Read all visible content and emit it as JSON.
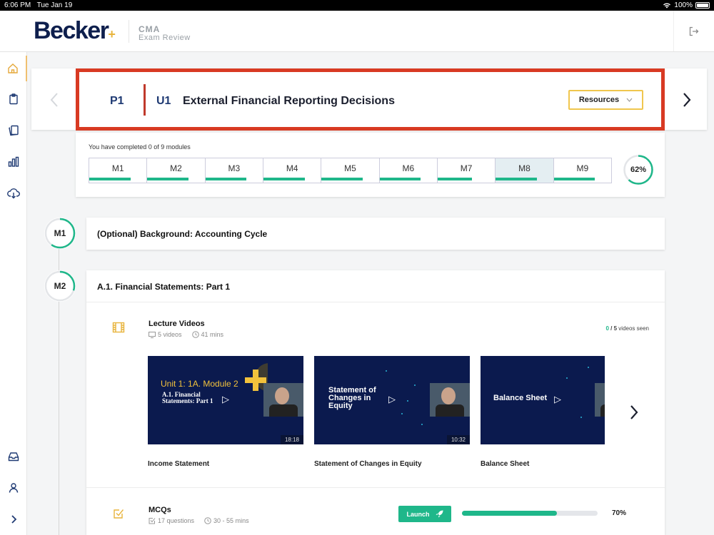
{
  "status": {
    "time": "6:06 PM",
    "date": "Tue Jan 19",
    "battery": "100%"
  },
  "header": {
    "logo": "Becker",
    "product_line1": "CMA",
    "product_line2": "Exam Review"
  },
  "banner": {
    "part": "P1",
    "unit": "U1",
    "title": "External Financial Reporting Decisions",
    "resources_label": "Resources"
  },
  "progress": {
    "summary": "You have completed 0 of 9 modules",
    "modules": [
      {
        "label": "M1",
        "fill": 0.72
      },
      {
        "label": "M2",
        "fill": 0.72
      },
      {
        "label": "M3",
        "fill": 0.72
      },
      {
        "label": "M4",
        "fill": 0.72
      },
      {
        "label": "M5",
        "fill": 0.72
      },
      {
        "label": "M6",
        "fill": 0.72
      },
      {
        "label": "M7",
        "fill": 0.6
      },
      {
        "label": "M8",
        "fill": 0.72
      },
      {
        "label": "M9",
        "fill": 0.72
      }
    ],
    "overall_label": "62%",
    "overall_value": 0.62
  },
  "module1": {
    "badge": "M1",
    "title": "(Optional) Background: Accounting Cycle",
    "ring": 0.6
  },
  "module2": {
    "badge": "M2",
    "title": "A.1. Financial Statements: Part 1",
    "ring": 0.3,
    "lecture": {
      "heading": "Lecture Videos",
      "videos_count": "5 videos",
      "duration": "41 mins",
      "seen_num": "0",
      "seen_total": "/ 5",
      "seen_label": "videos seen",
      "videos": [
        {
          "thumb_line1": "Unit 1: 1A. Module 2",
          "thumb_line2": "A.1. Financial",
          "thumb_line3": "Statements: Part 1",
          "duration": "18:18",
          "title": "Income Statement"
        },
        {
          "thumb_line1": "Statement of",
          "thumb_line2": "Changes in",
          "thumb_line3": "Equity",
          "duration": "10:32",
          "title": "Statement of Changes in Equity"
        },
        {
          "thumb_line1": "Balance Sheet",
          "duration": "",
          "title": "Balance Sheet"
        }
      ]
    },
    "mcq": {
      "heading": "MCQs",
      "questions": "17 questions",
      "duration": "30 - 55 mins",
      "launch_label": "Launch",
      "percent_label": "70%",
      "value": 0.7
    }
  },
  "colors": {
    "accent_green": "#1fb78a",
    "highlight_red": "#d83a23",
    "resources_border": "#f0c64e",
    "navy": "#1f3a73",
    "logo_plus": "#e8b43c"
  },
  "icons": [
    "home-icon",
    "clipboard-icon",
    "flashcards-icon",
    "bar-chart-icon",
    "download-icon",
    "inbox-icon",
    "user-icon",
    "chevron-right-icon",
    "logout-icon",
    "film-icon",
    "checkbox-icon",
    "clock-icon",
    "monitor-icon",
    "rocket-icon",
    "play-icon"
  ]
}
